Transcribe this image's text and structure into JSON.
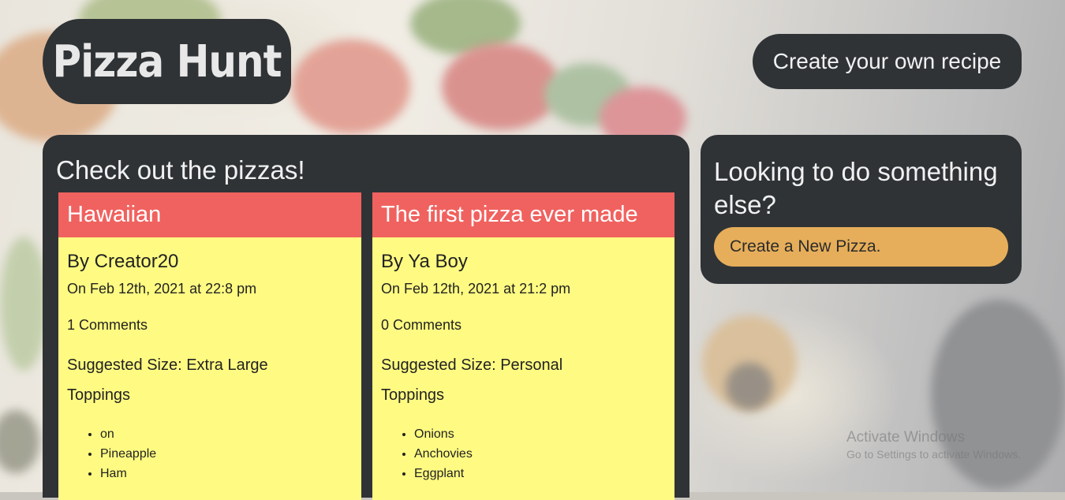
{
  "header": {
    "logo": "Pizza Hunt",
    "create_recipe_label": "Create your own recipe"
  },
  "main": {
    "title": "Check out the pizzas!",
    "pizzas": [
      {
        "name": "Hawaiian",
        "author": "By Creator20",
        "date": "On Feb 12th, 2021 at 22:8 pm",
        "comments": "1 Comments",
        "size": "Suggested Size: Extra Large",
        "toppings_label": "Toppings",
        "toppings": [
          "on",
          "Pineapple",
          "Ham"
        ]
      },
      {
        "name": "The first pizza ever made",
        "author": "By Ya Boy",
        "date": "On Feb 12th, 2021 at 21:2 pm",
        "comments": "0 Comments",
        "size": "Suggested Size: Personal",
        "toppings_label": "Toppings",
        "toppings": [
          "Onions",
          "Anchovies",
          "Eggplant"
        ]
      }
    ]
  },
  "side": {
    "title": "Looking to do something else?",
    "button_label": "Create a New Pizza."
  },
  "watermark": {
    "line1": "Activate Windows",
    "line2": "Go to Settings to activate Windows."
  },
  "colors": {
    "panel": "#2f3336",
    "card_header": "#f0625f",
    "card_body": "#fffb82",
    "button": "#e6ae5a"
  }
}
